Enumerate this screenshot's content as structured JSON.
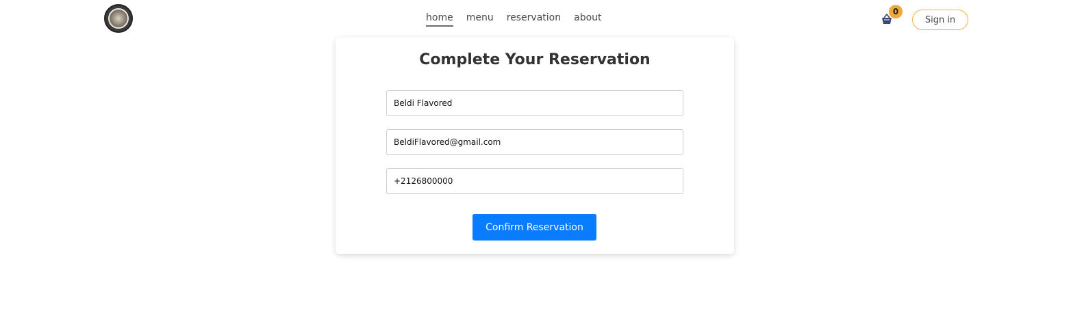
{
  "nav": {
    "items": [
      {
        "label": "home",
        "active": true
      },
      {
        "label": "menu"
      },
      {
        "label": "reservation"
      },
      {
        "label": "about"
      }
    ]
  },
  "cart": {
    "count": "0",
    "icon": "basket-icon",
    "badge_color": "#f2a93b"
  },
  "header": {
    "signin_label": "Sign in",
    "signin_border_color": "#f2b24c"
  },
  "form": {
    "title": "Complete Your Reservation",
    "name_value": "Beldi Flavored",
    "email_value": "BeldiFlavored@gmail.com",
    "phone_value": "+2126800000",
    "confirm_label": "Confirm Reservation",
    "confirm_color": "#0a7cff"
  }
}
